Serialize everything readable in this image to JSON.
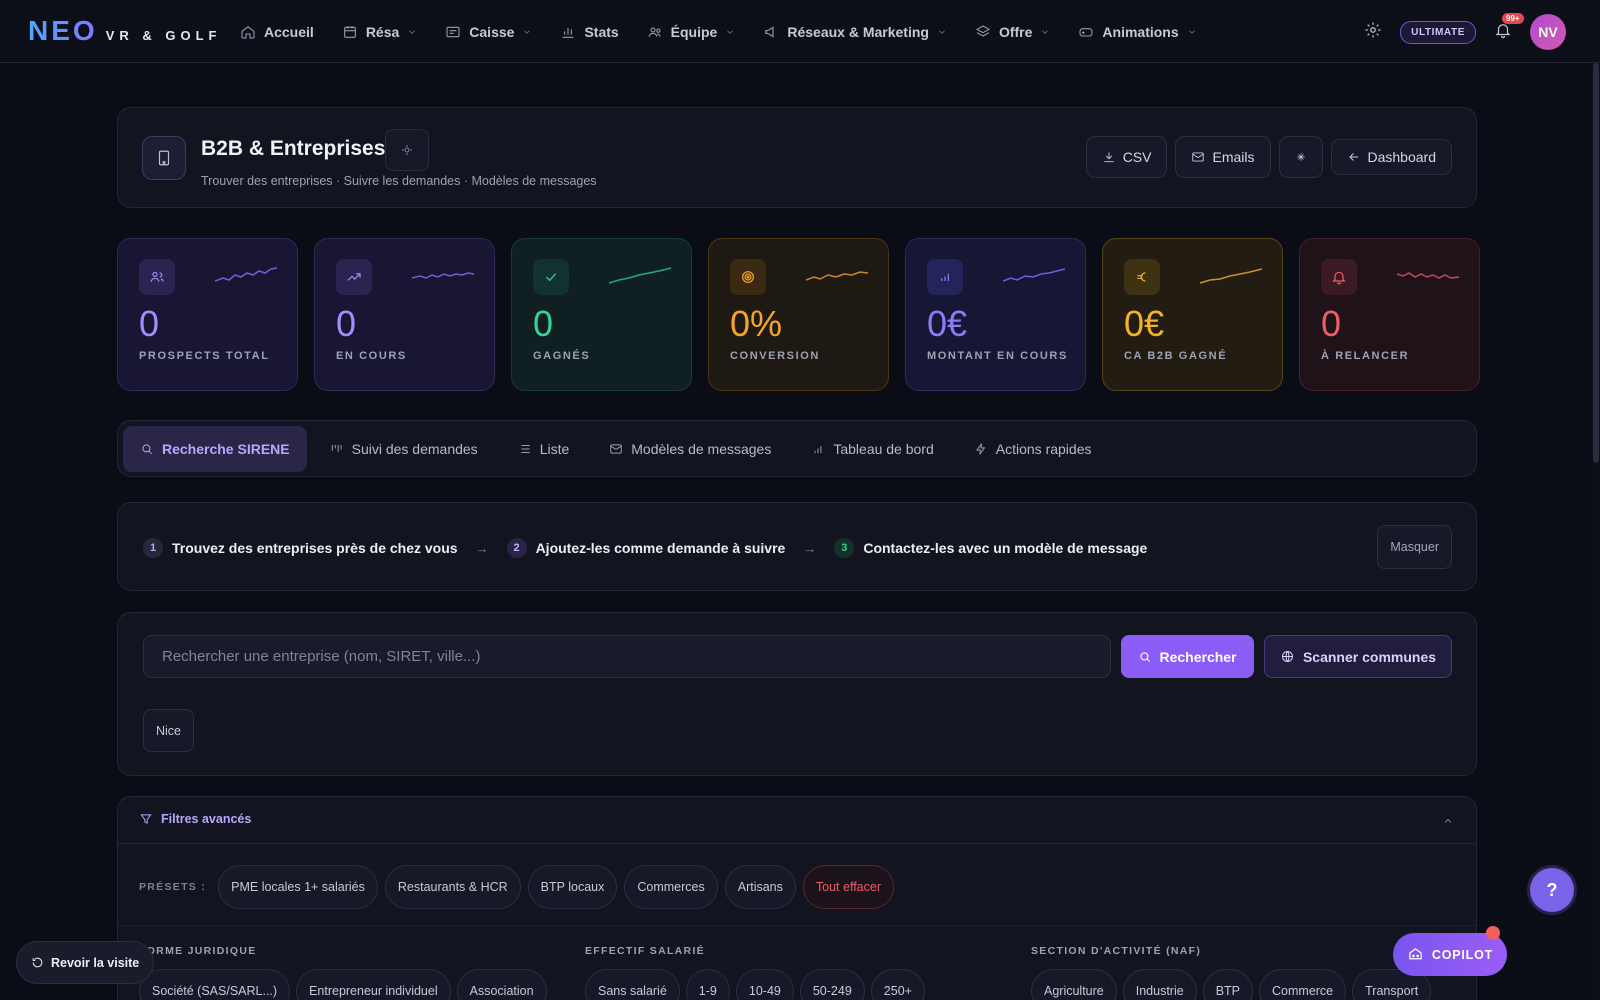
{
  "brand": {
    "name": "NEO",
    "tagline": "VR & GOLF"
  },
  "nav": {
    "items": [
      {
        "label": "Accueil",
        "icon": "home-icon",
        "dropdown": false
      },
      {
        "label": "Résa",
        "icon": "calendar-icon",
        "dropdown": true
      },
      {
        "label": "Caisse",
        "icon": "register-icon",
        "dropdown": true
      },
      {
        "label": "Stats",
        "icon": "bar-chart-icon",
        "dropdown": false
      },
      {
        "label": "Équipe",
        "icon": "team-icon",
        "dropdown": true
      },
      {
        "label": "Réseaux & Marketing",
        "icon": "megaphone-icon",
        "dropdown": true
      },
      {
        "label": "Offre",
        "icon": "layers-icon",
        "dropdown": true
      },
      {
        "label": "Animations",
        "icon": "gamepad-icon",
        "dropdown": true
      }
    ],
    "plan_badge": "ULTIMATE",
    "notifications": "99+",
    "avatar_initials": "NV"
  },
  "header": {
    "title": "B2B & Entreprises",
    "subtitle": "Trouver des entreprises · Suivre les demandes · Modèles de messages",
    "actions": {
      "csv": "CSV",
      "emails": "Emails",
      "dashboard": "Dashboard"
    }
  },
  "stats": [
    {
      "value": "0",
      "label": "PROSPECTS TOTAL",
      "icon": "users-icon",
      "color": "#a78bfa"
    },
    {
      "value": "0",
      "label": "EN COURS",
      "icon": "trending-up-icon",
      "color": "#a78bfa"
    },
    {
      "value": "0",
      "label": "GAGNÉS",
      "icon": "check-icon",
      "color": "#34d399"
    },
    {
      "value": "0%",
      "label": "CONVERSION",
      "icon": "target-icon",
      "color": "#f5a524"
    },
    {
      "value": "0€",
      "label": "MONTANT EN COURS",
      "icon": "bar-chart-icon",
      "color": "#8b7cf6"
    },
    {
      "value": "0€",
      "label": "CA B2B GAGNÉ",
      "icon": "euro-icon",
      "color": "#f5b324"
    },
    {
      "value": "0",
      "label": "À RELANCER",
      "icon": "bell-icon",
      "color": "#f05c6c"
    }
  ],
  "tabs": [
    {
      "label": "Recherche SIRENE",
      "icon": "search-icon",
      "active": true
    },
    {
      "label": "Suivi des demandes",
      "icon": "kanban-icon",
      "active": false
    },
    {
      "label": "Liste",
      "icon": "list-icon",
      "active": false
    },
    {
      "label": "Modèles de messages",
      "icon": "mail-icon",
      "active": false
    },
    {
      "label": "Tableau de bord",
      "icon": "bar-chart-icon",
      "active": false
    },
    {
      "label": "Actions rapides",
      "icon": "zap-icon",
      "active": false
    }
  ],
  "steps": {
    "items": [
      {
        "num": "1",
        "label": "Trouvez des entreprises près de chez vous"
      },
      {
        "num": "2",
        "label": "Ajoutez-les comme demande à suivre"
      },
      {
        "num": "3",
        "label": "Contactez-les avec un modèle de message"
      }
    ],
    "hide_label": "Masquer"
  },
  "search": {
    "placeholder": "Rechercher une entreprise (nom, SIRET, ville...)",
    "value": "",
    "search_button": "Rechercher",
    "scan_button": "Scanner communes",
    "city_chip": "Nice"
  },
  "filters": {
    "title": "Filtres avancés",
    "presets_label": "PRÉSETS :",
    "presets": [
      "PME locales 1+ salariés",
      "Restaurants & HCR",
      "BTP locaux",
      "Commerces",
      "Artisans"
    ],
    "clear_label": "Tout effacer",
    "groups": [
      {
        "title": "FORME JURIDIQUE",
        "options": [
          "Société (SAS/SARL...)",
          "Entrepreneur individuel",
          "Association"
        ]
      },
      {
        "title": "EFFECTIF SALARIÉ",
        "options": [
          "Sans salarié",
          "1-9",
          "10-49",
          "50-249",
          "250+"
        ]
      },
      {
        "title": "SECTION D'ACTIVITÉ (NAF)",
        "options": [
          "Agriculture",
          "Industrie",
          "BTP",
          "Commerce",
          "Transport"
        ]
      }
    ]
  },
  "floating": {
    "revisit": "Revoir la visite",
    "copilot": "COPILOT",
    "help": "?"
  }
}
